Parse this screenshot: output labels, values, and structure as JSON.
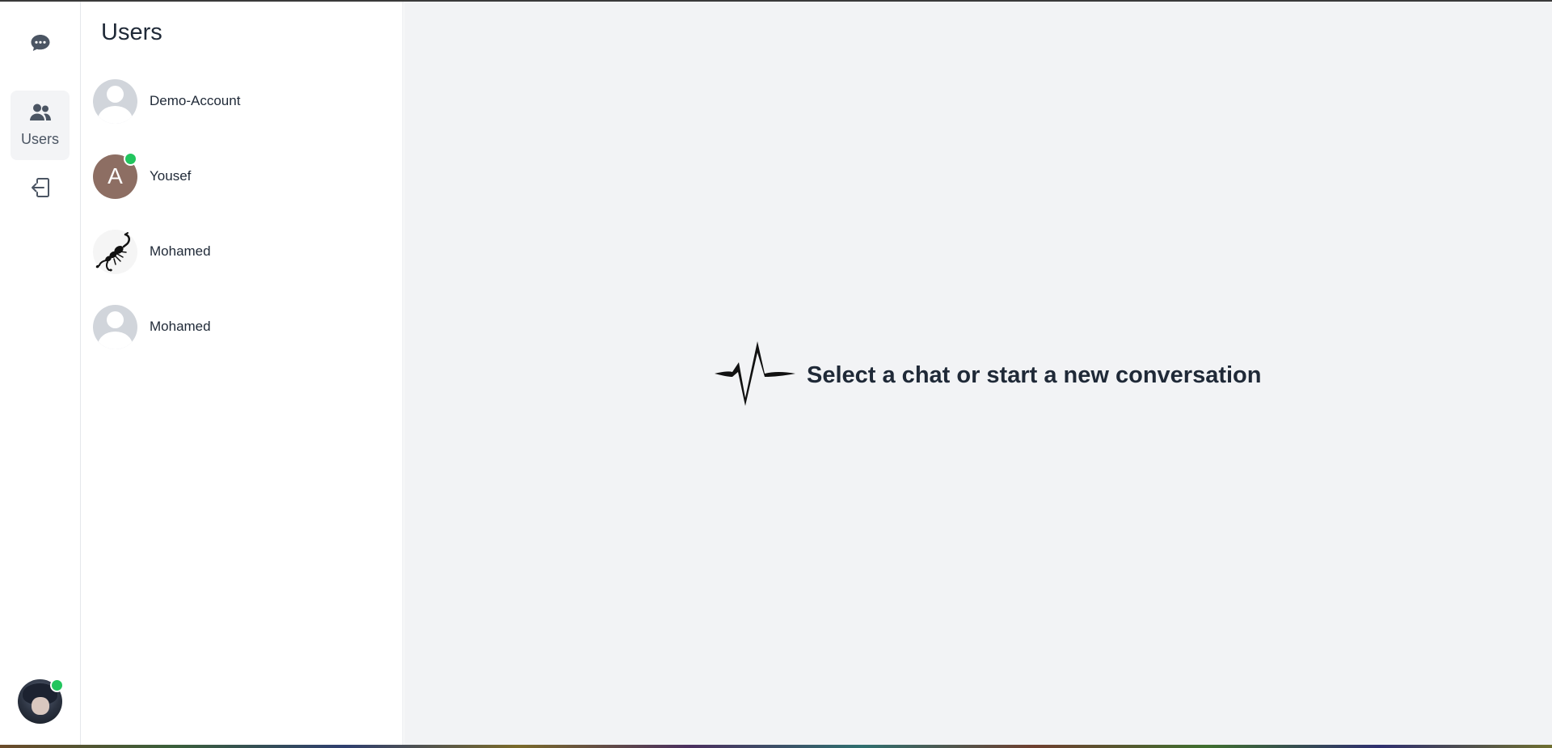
{
  "rail": {
    "chat_icon": "chat-bubble-icon",
    "users_icon": "users-icon",
    "users_label": "Users",
    "logout_icon": "logout-icon",
    "current_user_status": "online"
  },
  "users_panel": {
    "title": "Users",
    "users": [
      {
        "name": "Demo-Account",
        "avatar": "placeholder",
        "online": false
      },
      {
        "name": "Yousef",
        "avatar": "letter",
        "initial": "A",
        "online": true
      },
      {
        "name": "Mohamed",
        "avatar": "scorpion-image",
        "online": false
      },
      {
        "name": "Mohamed",
        "avatar": "placeholder",
        "online": false
      }
    ]
  },
  "main": {
    "empty_icon": "pulse-waveform-icon",
    "empty_message": "Select a chat or start a new conversation"
  },
  "colors": {
    "online": "#22c55e",
    "main_bg": "#f2f3f5",
    "letter_avatar_bg": "#8d6e63"
  }
}
